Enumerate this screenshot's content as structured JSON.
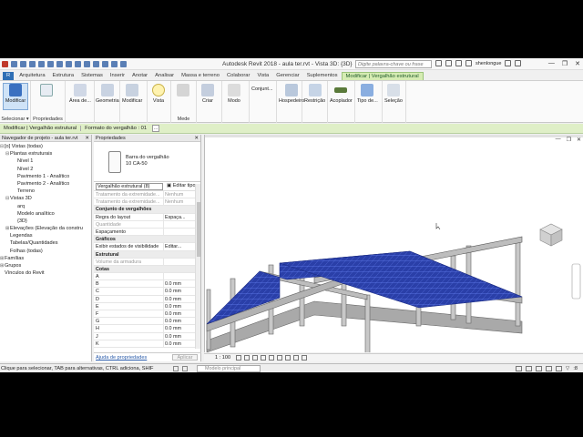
{
  "app": {
    "title": "Autodesk Revit 2018 -     aula ter.rvt - Vista 3D: {3D}",
    "search_placeholder": "Digite palavra-chave ou frase",
    "user": "shenlongue",
    "window_controls": [
      "—",
      "❐",
      "✕"
    ]
  },
  "tabs": [
    {
      "label": "R",
      "file": true
    },
    {
      "label": "Arquitetura"
    },
    {
      "label": "Estrutura"
    },
    {
      "label": "Sistemas"
    },
    {
      "label": "Inserir"
    },
    {
      "label": "Anotar"
    },
    {
      "label": "Analisar"
    },
    {
      "label": "Massa e terreno"
    },
    {
      "label": "Colaborar"
    },
    {
      "label": "Vista"
    },
    {
      "label": "Gerenciar"
    },
    {
      "label": "Suplementos"
    },
    {
      "label": "Modificar | Vergalhão estrutural",
      "active": true
    }
  ],
  "ribbon": {
    "select_btn": "Modificar",
    "area_btn": "Área de...",
    "geometry_btn": "Geometria",
    "modify_btn": "Modificar",
    "view_btn": "Vista",
    "measure_btn": "Mede",
    "create_btn": "Criar",
    "mode_btn": "Modo",
    "conjunto_btn": "Conjunt...",
    "host_btn": "Hospedeiro",
    "restrict_btn": "Restrição",
    "coupler_btn": "Acoplador",
    "type_btn": "Tipo de...",
    "selection_btn": "Seleção",
    "panel_select": "Selecionar ▾",
    "panel_props": "Propriedades",
    "panel_measure": "Medir"
  },
  "optbar": {
    "context": "Modificar | Vergalhão estrutural",
    "format_label": "Formato do vergalhão : 01",
    "dots": "..."
  },
  "browser": {
    "title": "Navegador de projeto - aula ter.rvt",
    "items": [
      {
        "label": "[o] Vistas (todas)",
        "toggle": "⊟"
      },
      {
        "label": "Plantas estruturais",
        "toggle": "⊟"
      },
      {
        "label": "Nível 1",
        "toggle": ""
      },
      {
        "label": "Nível 2",
        "toggle": ""
      },
      {
        "label": "Pavimento 1 - Analítico",
        "toggle": ""
      },
      {
        "label": "Pavimento 2 - Analítico",
        "toggle": ""
      },
      {
        "label": "Terreno",
        "toggle": ""
      },
      {
        "label": "Vistas 3D",
        "toggle": "⊟"
      },
      {
        "label": "arq",
        "toggle": ""
      },
      {
        "label": "Modelo analítico",
        "toggle": ""
      },
      {
        "label": "{3D}",
        "toggle": ""
      },
      {
        "label": "Elevações (Elevação da constru",
        "toggle": "⊞"
      },
      {
        "label": "Legendas",
        "toggle": ""
      },
      {
        "label": "Tabelas/Quantidades",
        "toggle": ""
      },
      {
        "label": "Folhas (todas)",
        "toggle": ""
      },
      {
        "label": "Famílias",
        "toggle": "⊞"
      },
      {
        "label": "Grupos",
        "toggle": "⊞"
      },
      {
        "label": "Vínculos do Revit",
        "toggle": ""
      }
    ]
  },
  "properties": {
    "title": "Propriedades",
    "type_name_1": "Barra do vergalhão",
    "type_name_2": "10 CA-50",
    "selector": "Vergalhão estrutural (8)",
    "edit_type": "Editar tipo",
    "rows": [
      {
        "k": "Tratamento da extremidade...",
        "v": "Nenhum",
        "kind": "dis"
      },
      {
        "k": "Tratamento da extremidade...",
        "v": "Nenhum",
        "kind": "dis"
      },
      {
        "k": "Conjunto de vergalhões",
        "v": "",
        "kind": "grp"
      },
      {
        "k": "Regra do layout",
        "v": "Espaça...",
        "kind": ""
      },
      {
        "k": "Quantidade",
        "v": "",
        "kind": "dis"
      },
      {
        "k": "Espaçamento",
        "v": "",
        "kind": ""
      },
      {
        "k": "Gráficos",
        "v": "",
        "kind": "grp"
      },
      {
        "k": "Exibir estados de visibilidade",
        "v": "Editar...",
        "kind": ""
      },
      {
        "k": "Estrutural",
        "v": "",
        "kind": "grp"
      },
      {
        "k": "Volume da armadura",
        "v": "",
        "kind": "dis"
      },
      {
        "k": "Cotas",
        "v": "",
        "kind": "grp"
      },
      {
        "k": "A",
        "v": "",
        "kind": ""
      },
      {
        "k": "B",
        "v": "0.0 mm",
        "kind": ""
      },
      {
        "k": "C",
        "v": "0.0 mm",
        "kind": ""
      },
      {
        "k": "D",
        "v": "0.0 mm",
        "kind": ""
      },
      {
        "k": "E",
        "v": "0.0 mm",
        "kind": ""
      },
      {
        "k": "F",
        "v": "0.0 mm",
        "kind": ""
      },
      {
        "k": "G",
        "v": "0.0 mm",
        "kind": ""
      },
      {
        "k": "H",
        "v": "0.0 mm",
        "kind": ""
      },
      {
        "k": "J",
        "v": "0.0 mm",
        "kind": ""
      },
      {
        "k": "K",
        "v": "0.0 mm",
        "kind": ""
      }
    ],
    "help_link": "Ajuda de propriedades",
    "apply": "Aplicar"
  },
  "viewport": {
    "scale": "1 : 100",
    "controls": [
      "—",
      "❐",
      "✕"
    ]
  },
  "status": {
    "text": "Clique para selecionar, TAB para alternativas, CTRL adiciona, SHIF",
    "model": "Modelo principal",
    "filter": ":8"
  },
  "colors": {
    "accent_tab": "#d6ecb3",
    "rebar_blue": "#2a3fa8",
    "concrete": "#b7b7b7"
  }
}
